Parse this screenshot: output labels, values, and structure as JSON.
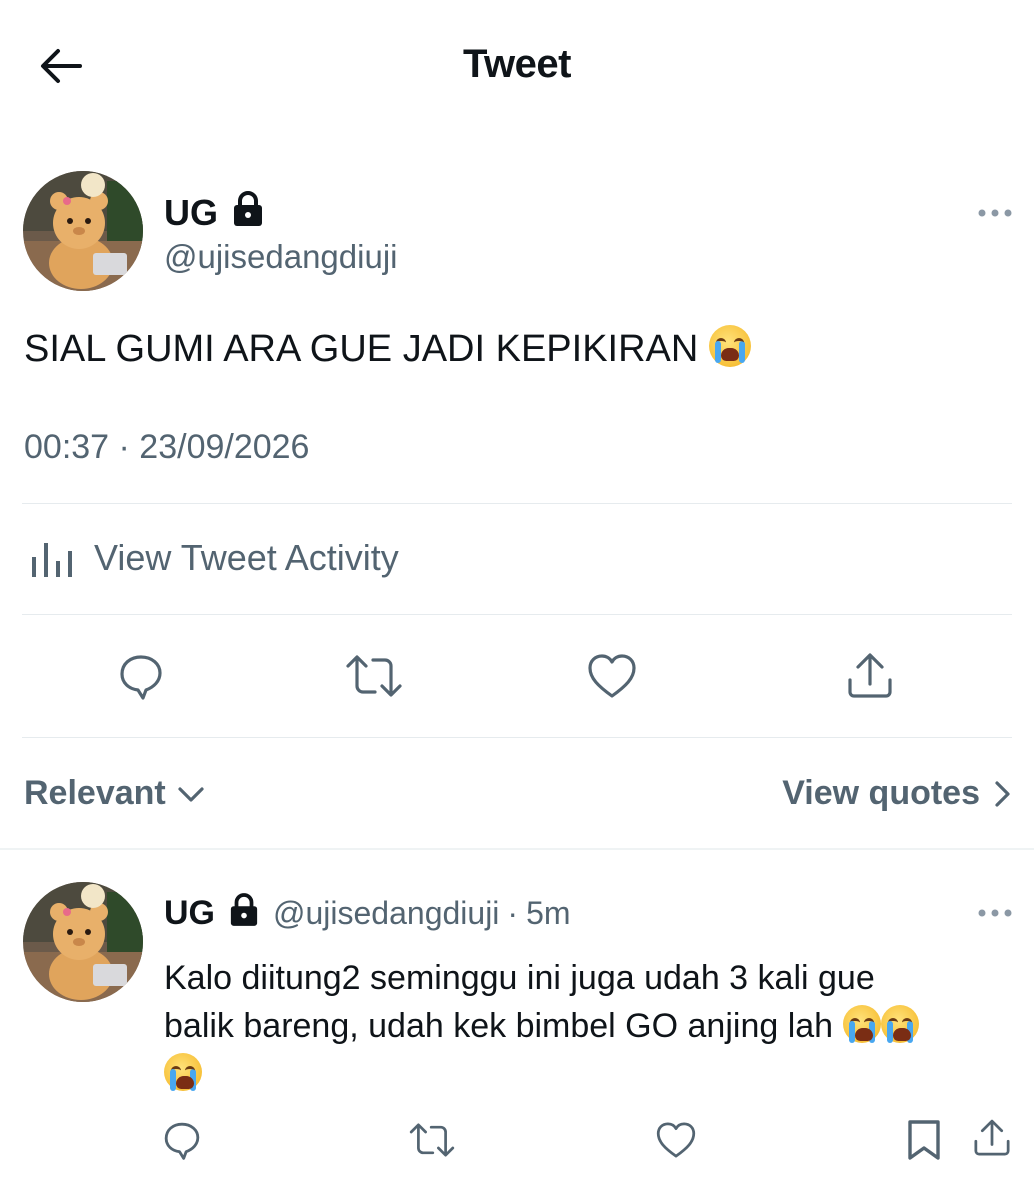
{
  "header": {
    "title": "Tweet",
    "back_icon": "back-arrow-icon"
  },
  "tweet": {
    "display_name": "UG",
    "handle": "@ujisedangdiuji",
    "protected_icon": "lock-icon",
    "text": "SIAL GUMI ARA GUE JADI KEPIKIRAN",
    "text_emoji": "loudly-crying-face",
    "timestamp": "00:37 · 23/09/2026",
    "activity_label": "View Tweet Activity",
    "actions": [
      "reply-icon",
      "retweet-icon",
      "like-icon",
      "share-icon"
    ]
  },
  "filter": {
    "sort_label": "Relevant",
    "quotes_label": "View quotes"
  },
  "reply": {
    "display_name": "UG",
    "handle": "@ujisedangdiuji",
    "separator": "·",
    "time": "5m",
    "text_line1": "Kalo diitung2 seminggu ini juga udah 3 kali gue",
    "text_line2": "balik bareng, udah kek bimbel GO anjing lah",
    "emoji_count": 3,
    "actions": [
      "reply-icon",
      "retweet-icon",
      "like-icon",
      "bookmark-icon",
      "share-icon"
    ]
  },
  "colors": {
    "text_primary": "#0f1419",
    "text_secondary": "#536471",
    "divider": "#eff3f4"
  }
}
